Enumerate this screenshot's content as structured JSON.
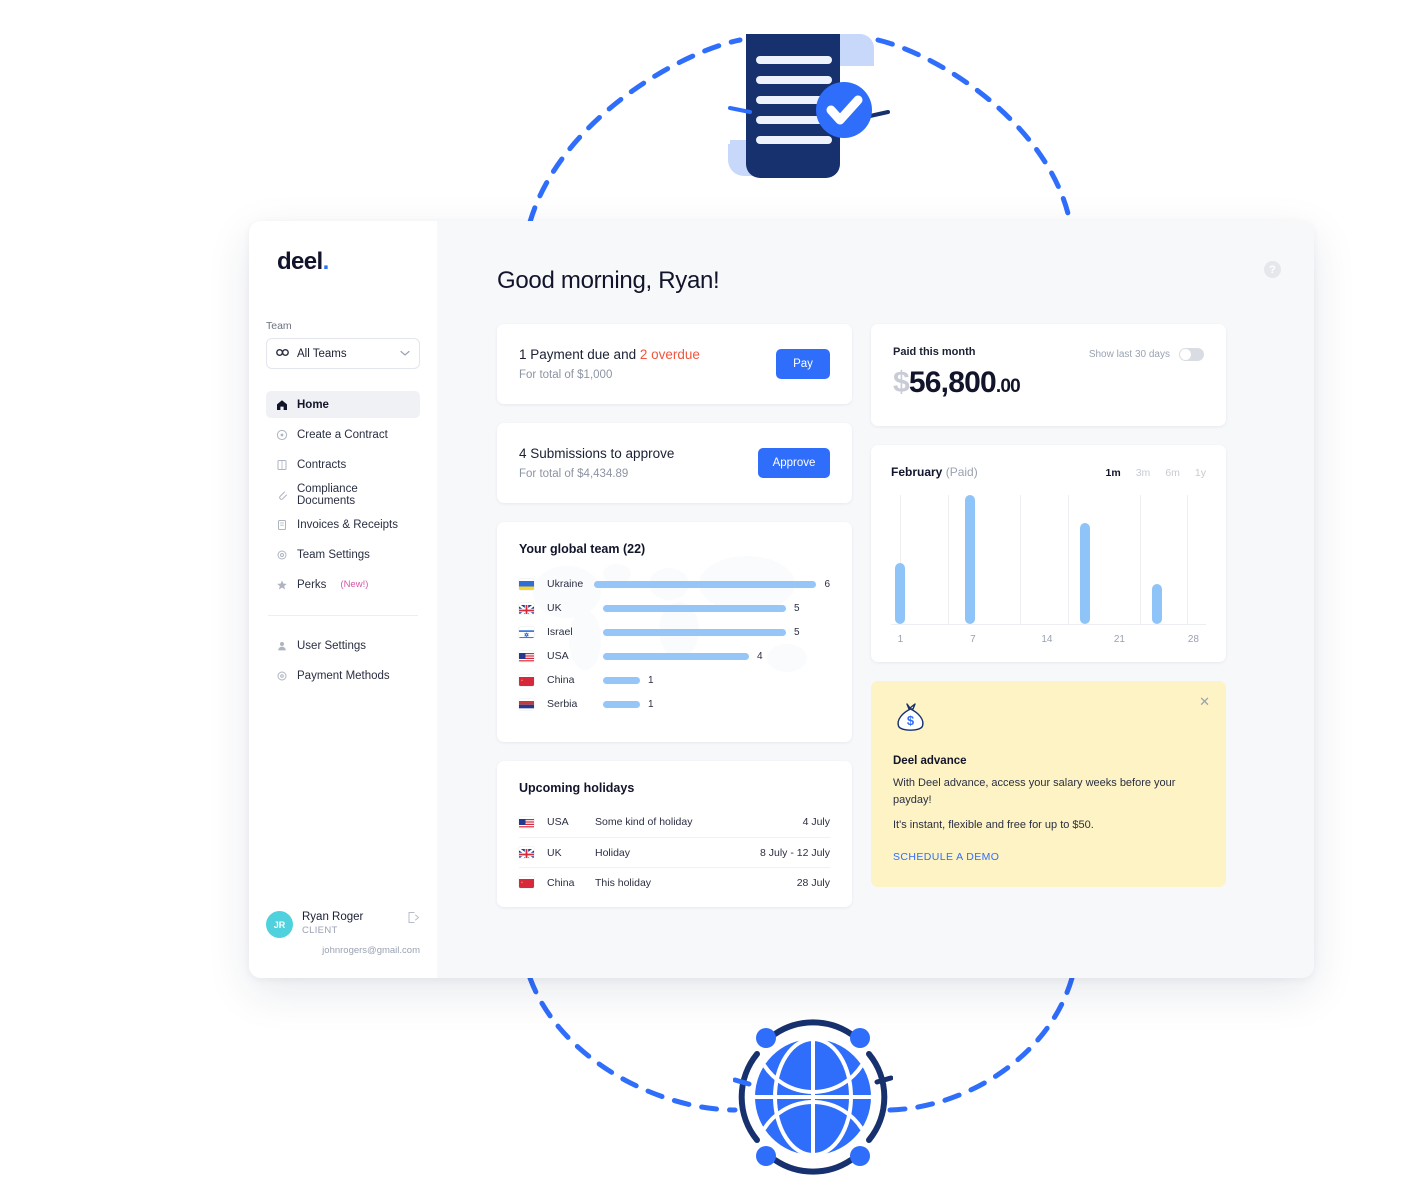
{
  "sidebar": {
    "logo": "deel",
    "logo_dot": ".",
    "team_label": "Team",
    "team_select_value": "All Teams",
    "nav": [
      {
        "label": "Home",
        "icon": "home-icon",
        "active": true
      },
      {
        "label": "Create a Contract",
        "icon": "plus-circle-icon",
        "active": false
      },
      {
        "label": "Contracts",
        "icon": "document-icon",
        "active": false
      },
      {
        "label": "Compliance Documents",
        "icon": "paperclip-icon",
        "active": false
      },
      {
        "label": "Invoices & Receipts",
        "icon": "receipt-icon",
        "active": false
      },
      {
        "label": "Team Settings",
        "icon": "gear-icon",
        "active": false
      },
      {
        "label": "Perks",
        "icon": "star-icon",
        "active": false,
        "badge": "(New!)"
      }
    ],
    "nav_secondary": [
      {
        "label": "User Settings",
        "icon": "user-icon"
      },
      {
        "label": "Payment Methods",
        "icon": "circle-icon"
      }
    ],
    "user": {
      "initials": "JR",
      "name": "Ryan Roger",
      "role": "CLIENT",
      "email": "johnrogers@gmail.com"
    }
  },
  "main": {
    "greeting": "Good morning, Ryan!",
    "help_icon": "?",
    "payment_card": {
      "title_prefix": "1 Payment due and ",
      "title_overdue": "2 overdue",
      "subtitle": "For total of $1,000",
      "button": "Pay"
    },
    "submissions_card": {
      "title": "4 Submissions to approve",
      "subtitle": "For total of $4,434.89",
      "button": "Approve"
    },
    "team_card": {
      "title": "Your global team (22)"
    },
    "holidays_card": {
      "title": "Upcoming holidays",
      "rows": [
        {
          "flag": "us",
          "country": "USA",
          "name": "Some kind of holiday",
          "date": "4 July"
        },
        {
          "flag": "uk",
          "country": "UK",
          "name": "Holiday",
          "date": "8 July - 12 July"
        },
        {
          "flag": "cn",
          "country": "China",
          "name": "This holiday",
          "date": "28 July"
        }
      ]
    },
    "paid_card": {
      "label": "Paid this month",
      "currency": "$",
      "amount": "56,800",
      "cents": ".00",
      "toggle_label": "Show last 30 days",
      "toggle_on": false
    },
    "promo": {
      "icon": "money-bag-icon",
      "close_icon": "✕",
      "title": "Deel advance",
      "line1": "With Deel advance, access your salary weeks before your payday!",
      "line2": "It's instant, flexible and free for up to $50.",
      "cta": "SCHEDULE A DEMO"
    }
  },
  "colors": {
    "accent_blue": "#2f6dfb",
    "bar_blue": "#96c5f7",
    "overdue_red": "#f1563f",
    "promo_yellow": "#fdf3c4",
    "badge_pink": "#d857a8",
    "navy": "#17316e"
  },
  "chart_data": [
    {
      "type": "bar",
      "orientation": "horizontal",
      "title": "Your global team (22)",
      "categories": [
        "Ukraine",
        "UK",
        "Israel",
        "USA",
        "China",
        "Serbia"
      ],
      "flags": [
        "ua",
        "uk",
        "il",
        "us",
        "cn",
        "rs"
      ],
      "values": [
        6,
        5,
        5,
        4,
        1,
        1
      ],
      "xlabel": "",
      "ylabel": "",
      "xlim": [
        0,
        6
      ],
      "grid": false,
      "legend": null
    },
    {
      "type": "bar",
      "orientation": "vertical",
      "title": "February",
      "subtitle": "(Paid)",
      "ranges": [
        "1m",
        "3m",
        "6m",
        "1y"
      ],
      "active_range": "1m",
      "x": [
        1,
        7,
        17.5,
        24.5
      ],
      "values": [
        47,
        100,
        78,
        31
      ],
      "xticks": [
        1,
        7,
        14,
        21,
        28
      ],
      "xlabel": "",
      "ylabel": "",
      "xlim": [
        0,
        29
      ],
      "ylim": [
        0,
        100
      ],
      "grid": true
    }
  ]
}
